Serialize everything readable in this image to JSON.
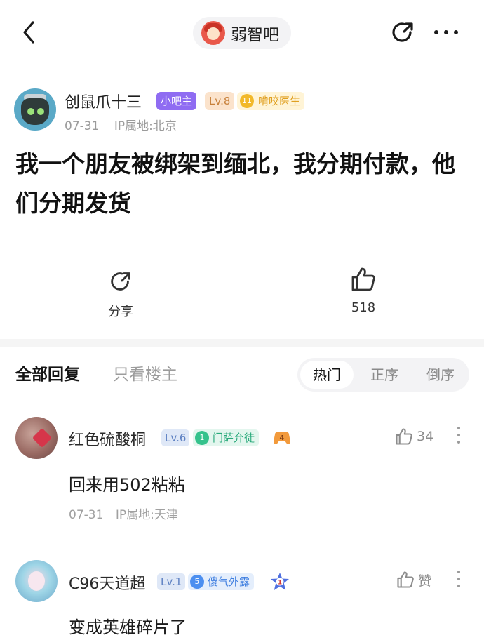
{
  "header": {
    "forum_name": "弱智吧",
    "back_icon": "chevron-left-icon",
    "share_icon": "share-icon",
    "more_icon": "more-horizontal-icon"
  },
  "post": {
    "author": {
      "name": "创鼠爪十三",
      "role_badge": "小吧主",
      "level": "Lv.8",
      "title_badge": "啃咬医生",
      "title_level": "11"
    },
    "date": "07-31",
    "ip": "IP属地:北京",
    "title": "我一个朋友被绑架到缅北，我分期付款，他们分期发货",
    "share_label": "分享",
    "like_count": "518"
  },
  "reply_tabs": {
    "all": "全部回复",
    "owner_only": "只看楼主"
  },
  "sort": {
    "hot": "热门",
    "asc": "正序",
    "desc": "倒序",
    "selected": "热门"
  },
  "comments": [
    {
      "name": "红色硫酸桐",
      "level": "Lv.6",
      "title_badge": "门萨弃徒",
      "title_level": "1",
      "text": "回来用502粘粘",
      "date": "07-31",
      "ip": "IP属地:天津",
      "likes": "34"
    },
    {
      "name": "C96天道超",
      "level": "Lv.1",
      "title_badge": "傻气外露",
      "title_level": "5",
      "text": "变成英雄碎片了",
      "likes": "赞"
    }
  ],
  "colors": {
    "owner_badge": "#8f6cf2",
    "level_badge_author": "#fbe3cc",
    "title_badge_green": "#35c28c",
    "title_badge_blue": "#4c8ff0"
  }
}
